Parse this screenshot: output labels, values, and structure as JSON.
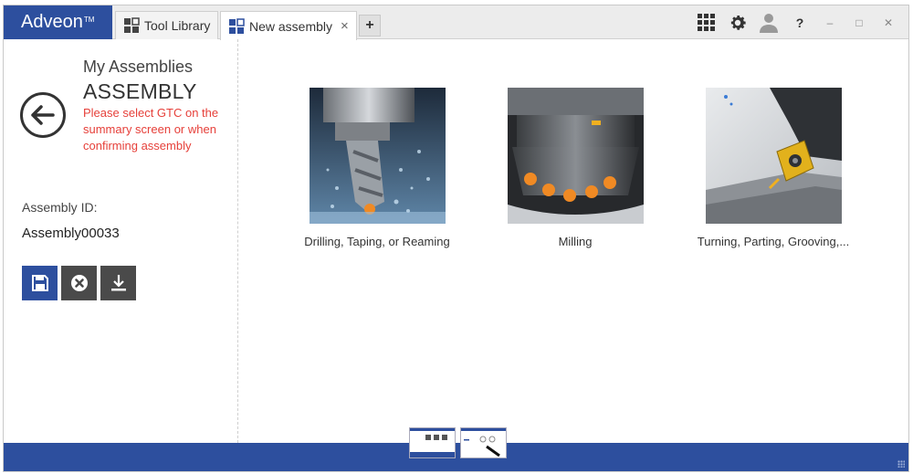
{
  "app": {
    "brand": "Adveon",
    "trademark": "TM"
  },
  "tabs": [
    {
      "label": "Tool Library",
      "icon": "library-icon",
      "active": false
    },
    {
      "label": "New assembly",
      "icon": "assembly-icon",
      "active": true,
      "close": "×"
    }
  ],
  "add_tab": "+",
  "toolbar": {
    "help": "?",
    "minimize": "–",
    "maximize": "□",
    "close": "✕"
  },
  "left": {
    "breadcrumb": "My Assemblies",
    "title": "ASSEMBLY",
    "warning": "Please select GTC on the summary screen or when confirming assembly",
    "assembly_id_label": "Assembly ID:",
    "assembly_id_value": "Assembly00033"
  },
  "categories": [
    {
      "label": "Drilling, Taping, or Reaming"
    },
    {
      "label": "Milling"
    },
    {
      "label": "Turning, Parting, Grooving,..."
    }
  ],
  "colors": {
    "brand": "#2d4f9e",
    "warning": "#e6403a",
    "dark_button": "#4a4a4a"
  }
}
